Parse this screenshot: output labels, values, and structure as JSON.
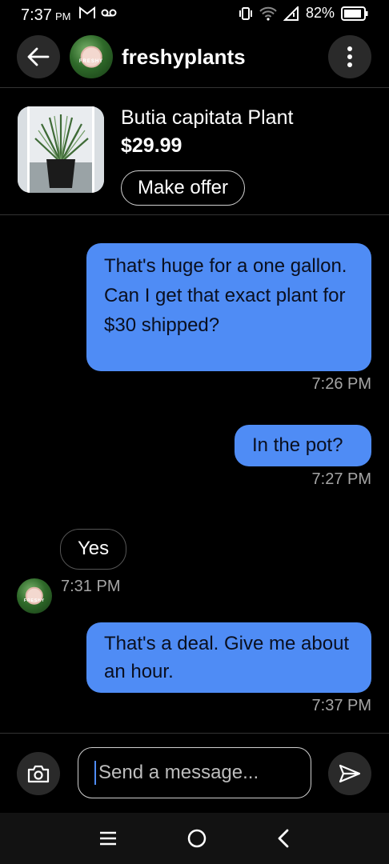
{
  "status_bar": {
    "time": "7:37",
    "ampm": "PM",
    "battery": "82%"
  },
  "header": {
    "username": "freshyplants",
    "avatar_tag": "FRESHY",
    "back_icon": "arrow-left-icon",
    "more_icon": "more-vertical-icon"
  },
  "product": {
    "title": "Butia capitata Plant",
    "price": "$29.99",
    "offer_button": "Make offer"
  },
  "messages": [
    {
      "direction": "out",
      "text": "That's huge for a one gallon. Can I get that exact plant for $30 shipped?",
      "time": "7:26 PM"
    },
    {
      "direction": "out",
      "text": "In the pot?",
      "time": "7:27 PM"
    },
    {
      "direction": "in",
      "text": "Yes",
      "time": "7:31 PM"
    },
    {
      "direction": "out",
      "text": "That's a deal. Give me about an hour.",
      "time": "7:37 PM"
    }
  ],
  "composer": {
    "placeholder": "Send a message...",
    "value": "",
    "camera_icon": "camera-icon",
    "send_icon": "send-icon"
  },
  "colors": {
    "outgoing_bubble": "#4f8cf5",
    "background": "#000000"
  }
}
